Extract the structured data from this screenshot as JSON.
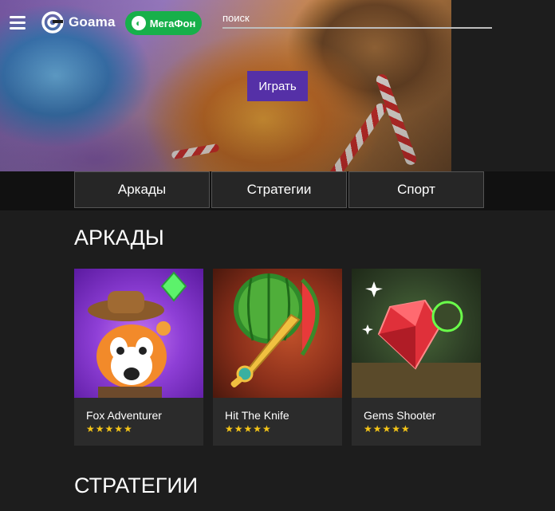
{
  "header": {
    "brand": "Goama",
    "partner": "МегаФон",
    "search_placeholder": "поиск"
  },
  "hero": {
    "play_label": "Играть"
  },
  "tabs": [
    "Аркады",
    "Стратегии",
    "Спорт"
  ],
  "sections": {
    "arcade_title": "АРКАДЫ",
    "strategy_title": "СТРАТЕГИИ"
  },
  "games": [
    {
      "title": "Fox Adventurer",
      "stars": "★★★★★",
      "rating": 5
    },
    {
      "title": "Hit The Knife",
      "stars": "★★★★★",
      "rating": 5
    },
    {
      "title": "Gems Shooter",
      "stars": "★★★★★",
      "rating": 5
    }
  ],
  "colors": {
    "accent": "#5530a7",
    "partner": "#17b04a",
    "star": "#f5c518",
    "background": "#1d1d1d"
  },
  "icons": [
    "menu-icon",
    "goama-logo-icon",
    "megafon-logo-icon",
    "star-icon"
  ]
}
